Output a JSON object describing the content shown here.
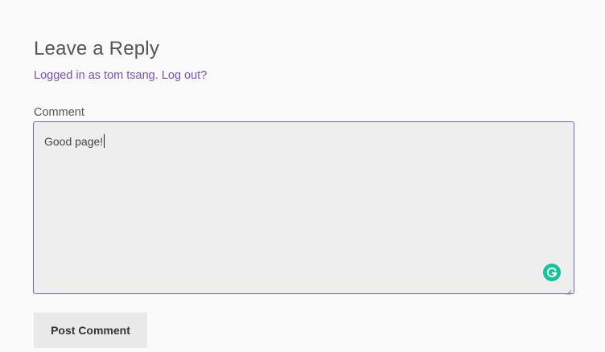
{
  "reply": {
    "title": "Leave a Reply",
    "logged_in_prefix": "Logged in as",
    "username": "tom tsang",
    "logout_label": "Log out?"
  },
  "comment": {
    "label": "Comment",
    "value": "Good page!"
  },
  "actions": {
    "post_label": "Post Comment"
  },
  "icons": {
    "grammarly": "grammarly-icon",
    "resize": "resize-handle-icon"
  },
  "colors": {
    "link": "#7b4fb5",
    "focus_border": "#7b5cbf",
    "grammarly": "#15c39a"
  }
}
